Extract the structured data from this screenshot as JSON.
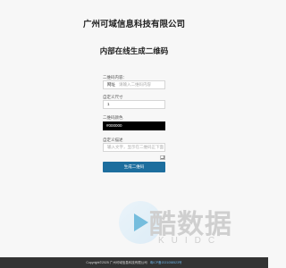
{
  "header": {
    "company": "广州可域信息科技有限公司",
    "page_title": "内部在线生成二维码"
  },
  "form": {
    "content_label": "二维码内容：",
    "content_prefix": "网址",
    "content_placeholder": "请输入二维码内容",
    "size_label": "自定义尺寸",
    "size_value": "1",
    "color_label": "二维码颜色",
    "color_value": "#000000",
    "text_label": "自定义描述",
    "text_placeholder": "输入文字，显示在二维码正下面",
    "generate_label": "生成二维码"
  },
  "watermark": {
    "brand": "酷数据",
    "brand_sub": "KUIDC"
  },
  "footer": {
    "copyright": "Copyright©2025 广州可域信息科技有限公司",
    "icp": "粤ICP备2021058523号"
  }
}
